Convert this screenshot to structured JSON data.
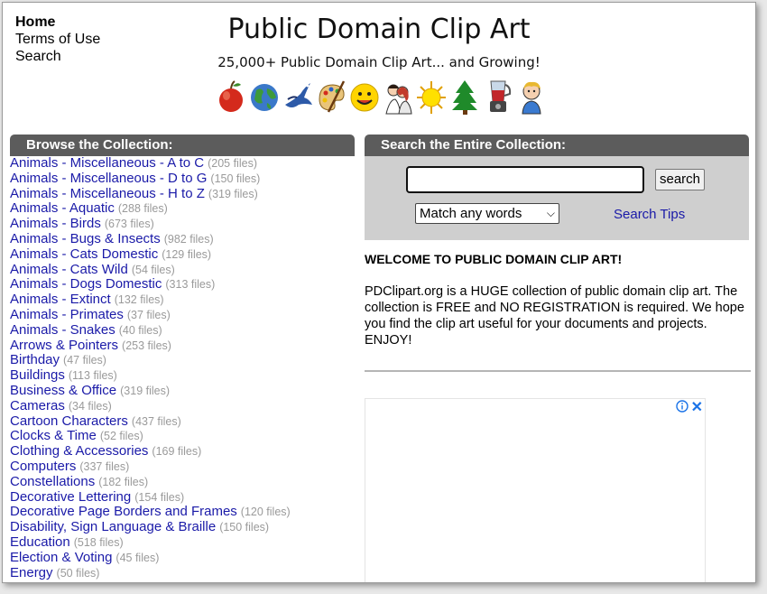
{
  "nav": {
    "home": "Home",
    "terms": "Terms of Use",
    "search": "Search"
  },
  "header": {
    "title": "Public Domain Clip Art",
    "tagline": "25,000+ Public Domain Clip Art... and Growing!"
  },
  "icons": [
    "apple-icon",
    "globe-icon",
    "bird-icon",
    "palette-icon",
    "smiley-icon",
    "couple-icon",
    "sun-icon",
    "tree-icon",
    "blender-icon",
    "boy-icon"
  ],
  "browse": {
    "heading": "Browse the Collection:",
    "categories": [
      {
        "name": "Animals - Miscellaneous - A to C",
        "count": "(205 files)"
      },
      {
        "name": "Animals - Miscellaneous - D to G",
        "count": "(150 files)"
      },
      {
        "name": "Animals - Miscellaneous - H to Z",
        "count": "(319 files)"
      },
      {
        "name": "Animals - Aquatic",
        "count": "(288 files)"
      },
      {
        "name": "Animals - Birds",
        "count": "(673 files)"
      },
      {
        "name": "Animals - Bugs & Insects",
        "count": "(982 files)"
      },
      {
        "name": "Animals - Cats Domestic",
        "count": "(129 files)"
      },
      {
        "name": "Animals - Cats Wild",
        "count": "(54 files)"
      },
      {
        "name": "Animals - Dogs Domestic",
        "count": "(313 files)"
      },
      {
        "name": "Animals - Extinct",
        "count": "(132 files)"
      },
      {
        "name": "Animals - Primates",
        "count": "(37 files)"
      },
      {
        "name": "Animals - Snakes",
        "count": "(40 files)"
      },
      {
        "name": "Arrows & Pointers",
        "count": "(253 files)"
      },
      {
        "name": "Birthday",
        "count": "(47 files)"
      },
      {
        "name": "Buildings",
        "count": "(113 files)"
      },
      {
        "name": "Business & Office",
        "count": "(319 files)"
      },
      {
        "name": "Cameras",
        "count": "(34 files)"
      },
      {
        "name": "Cartoon Characters",
        "count": "(437 files)"
      },
      {
        "name": "Clocks & Time",
        "count": "(52 files)"
      },
      {
        "name": "Clothing & Accessories",
        "count": "(169 files)"
      },
      {
        "name": "Computers",
        "count": "(337 files)"
      },
      {
        "name": "Constellations",
        "count": "(182 files)"
      },
      {
        "name": "Decorative Lettering",
        "count": "(154 files)"
      },
      {
        "name": "Decorative Page Borders and Frames",
        "count": "(120 files)"
      },
      {
        "name": "Disability, Sign Language & Braille",
        "count": "(150 files)"
      },
      {
        "name": "Education",
        "count": "(518 files)"
      },
      {
        "name": "Election & Voting",
        "count": "(45 files)"
      },
      {
        "name": "Energy",
        "count": "(50 files)"
      }
    ]
  },
  "search": {
    "heading": "Search the Entire Collection:",
    "input_value": "",
    "button_label": "search",
    "match_selected": "Match any words",
    "tips_label": "Search Tips"
  },
  "welcome": {
    "title": "WELCOME TO PUBLIC DOMAIN CLIP ART!",
    "text": "PDClipart.org is a HUGE collection of public domain clip art. The collection is FREE and NO REGISTRATION is required. We hope you find the clip art useful for your documents and projects. ENJOY!"
  },
  "ad": {
    "info_icon": "info-icon",
    "close_icon": "close-icon"
  },
  "colors": {
    "link": "#1a1aa8",
    "count": "#9a9a9a",
    "header_bar": "#5c5c5c",
    "search_bg": "#cfcfcf"
  }
}
